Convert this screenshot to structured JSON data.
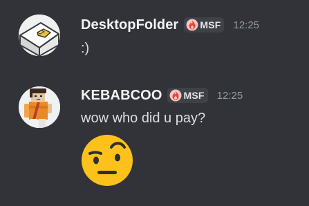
{
  "messages": [
    {
      "username": "DesktopFolder",
      "tag": "MSF",
      "tag_icon": "flame-icon",
      "timestamp": "12:25",
      "content": ":)",
      "avatar_icon": "folder-avatar-icon"
    },
    {
      "username": "KEBABCOO",
      "tag": "MSF",
      "tag_icon": "flame-icon",
      "timestamp": "12:25",
      "content": "wow who did u pay?",
      "avatar_icon": "character-avatar-icon",
      "attachment_emoji": "face-with-raised-eyebrow-emoji"
    }
  ],
  "colors": {
    "background": "#313338",
    "username": "#f2f3f5",
    "message_text": "#dbdee1",
    "timestamp": "#949ba4",
    "tag_background": "#3f4147",
    "flame": "#f04747"
  }
}
